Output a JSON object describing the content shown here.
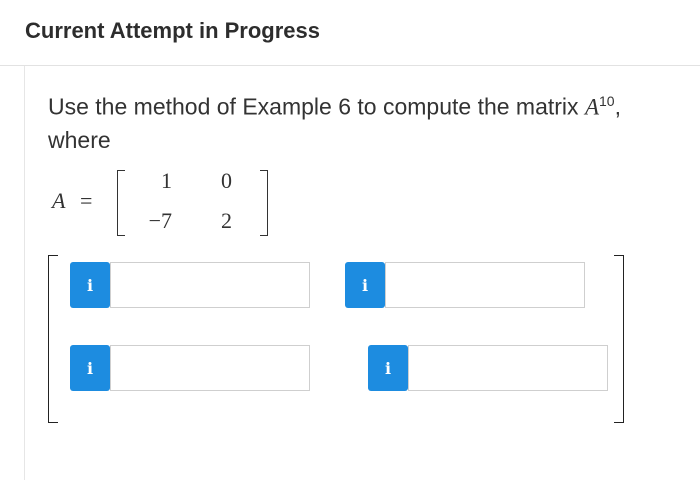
{
  "header": {
    "title": "Current Attempt in Progress"
  },
  "question": {
    "text_before": "Use the method of Example 6 to compute the matrix ",
    "matrix_var": "A",
    "exponent": "10",
    "text_after": ", where"
  },
  "matrix": {
    "name": "A",
    "equals": "=",
    "rows": [
      [
        "1",
        "0"
      ],
      [
        "−7",
        "2"
      ]
    ]
  },
  "answer": {
    "info_icon_glyph": "i",
    "fields": [
      {
        "value": "",
        "placeholder": ""
      },
      {
        "value": "",
        "placeholder": ""
      },
      {
        "value": "",
        "placeholder": ""
      },
      {
        "value": "",
        "placeholder": ""
      }
    ]
  },
  "colors": {
    "info_button": "#1d8ce0",
    "field_border": "#cfcfcf"
  }
}
